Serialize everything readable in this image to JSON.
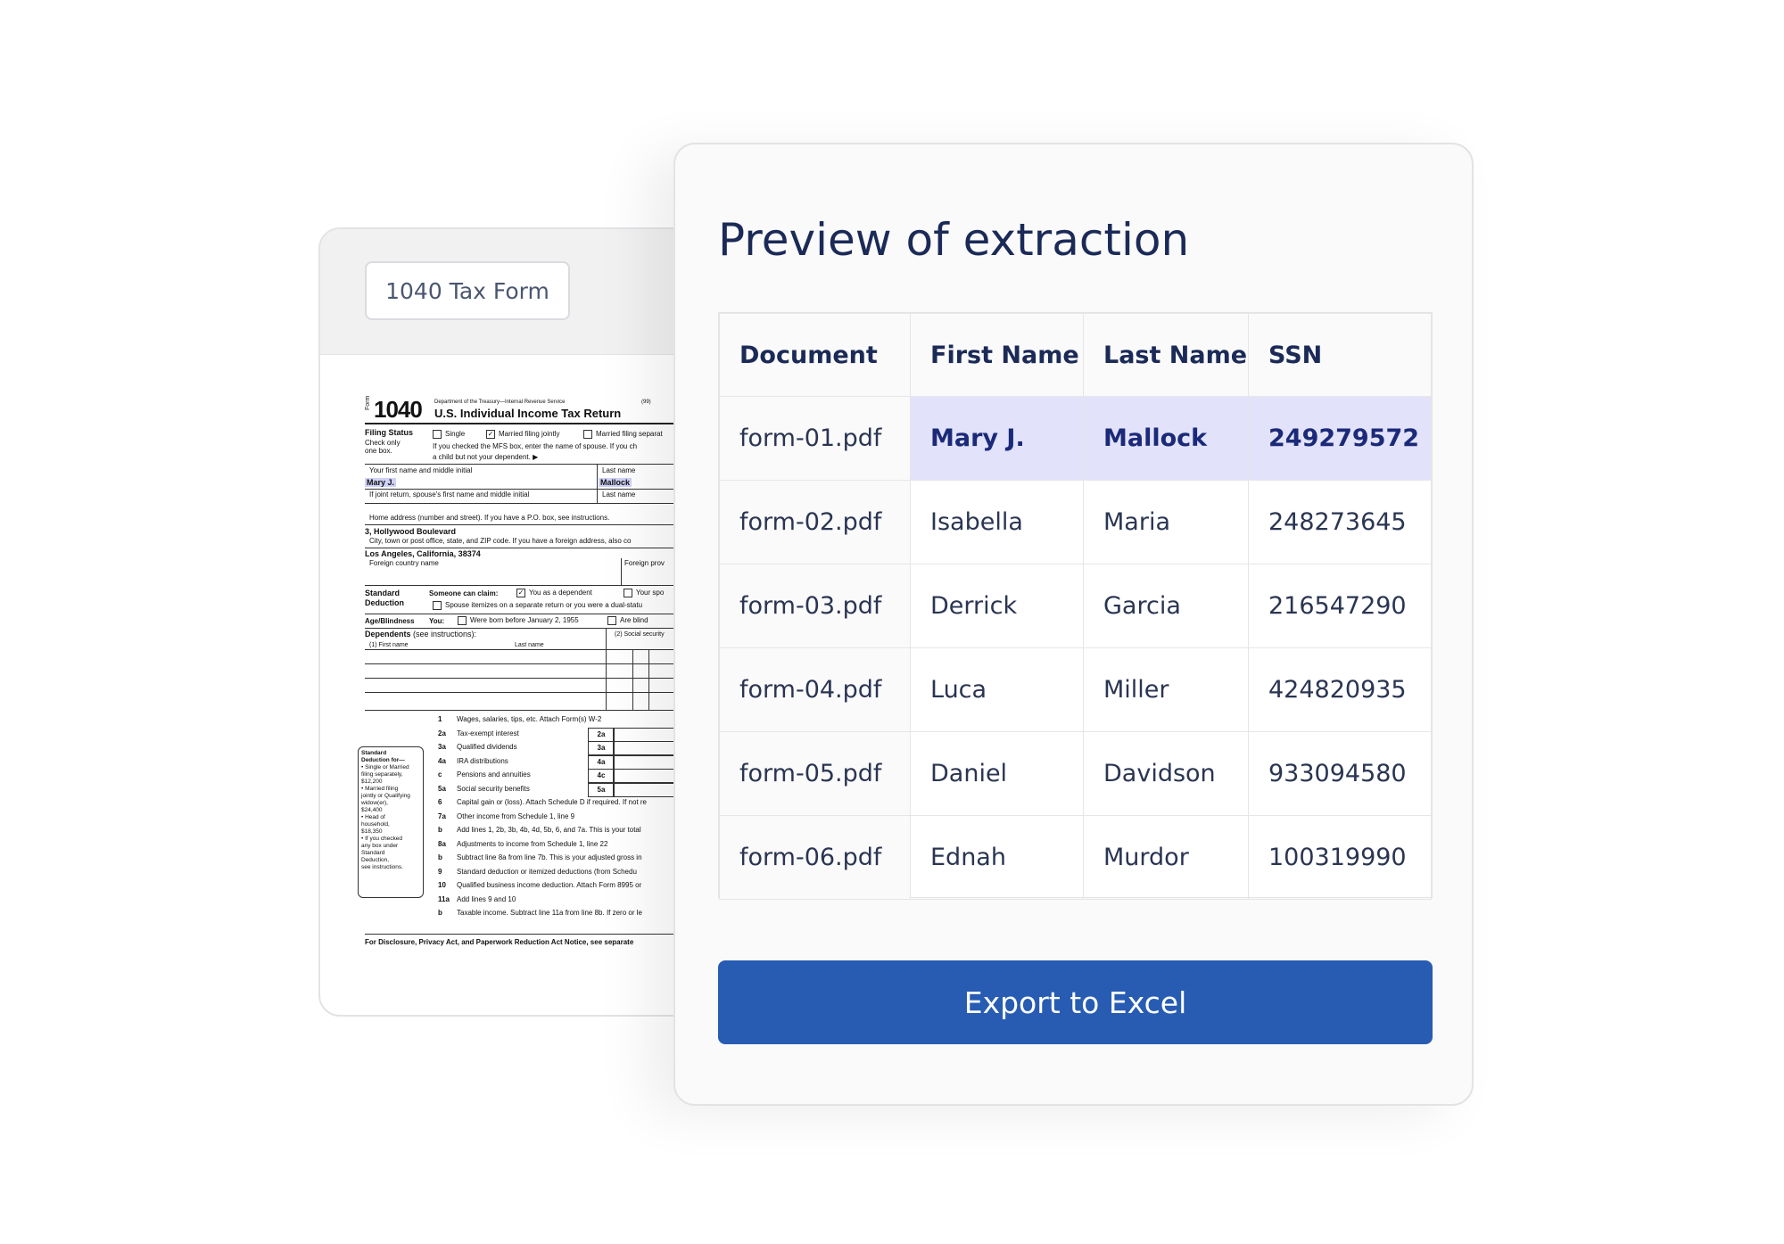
{
  "form_card": {
    "tag_label": "1040 Tax Form",
    "doc": {
      "form_label": "Form",
      "form_number": "1040",
      "dept": "Department of the Treasury—Internal Revenue Service",
      "code": "(99)",
      "title": "U.S. Individual Income Tax Return",
      "filing_status": "Filing Status",
      "check_only": "Check only",
      "one_box": "one box.",
      "single": "Single",
      "married_jointly": "Married filing jointly",
      "married_separately": "Married filing separat",
      "mfs_note": "If you checked the MFS box, enter the name of spouse. If you ch",
      "mfs_note2": "a child but not your dependent. ▶",
      "first_name_label": "Your first name and middle initial",
      "last_name_label": "Last name",
      "first_name_value": "Mary J.",
      "last_name_value": "Mallock",
      "spouse_label": "If joint return, spouse's first name and middle initial",
      "spouse_last_label": "Last name",
      "home_address_label": "Home address (number and street). If you have a P.O. box, see instructions.",
      "home_address_value": "3, Hollywood Boulevard",
      "city_label": "City, town or post office, state, and ZIP code. If you have a foreign address, also co",
      "city_value": "Los Angeles, California, 38374",
      "foreign_country": "Foreign country name",
      "foreign_prov": "Foreign prov",
      "standard": "Standard",
      "deduction": "Deduction",
      "someone_claim": "Someone can claim:",
      "you_dependent": "You as a dependent",
      "your_spouse": "Your spo",
      "spouse_itemizes": "Spouse itemizes on a separate return or you were a dual-statu",
      "age_blindness": "Age/Blindness",
      "you": "You:",
      "born_before": "Were born before January 2, 1955",
      "are_blind": "Are blind",
      "dependents": "Dependents",
      "see_instructions": "(see instructions):",
      "dep_first": "(1)  First name",
      "dep_last": "Last name",
      "dep_ssn": "(2)  Social security",
      "std_box": [
        "Standard",
        "Deduction for—",
        "• Single or Married",
        "filing separately,",
        "$12,200",
        "• Married filing",
        "jointly or Qualifying",
        "widow(er),",
        "$24,400",
        "• Head of",
        "household,",
        "$18,350",
        "• If you checked",
        "any box under",
        "Standard",
        "Deduction,",
        "see instructions."
      ],
      "lines": [
        {
          "num": "1",
          "text": "Wages, salaries, tips, etc. Attach Form(s) W-2",
          "box": ""
        },
        {
          "num": "2a",
          "text": "Tax-exempt interest",
          "box": "2a"
        },
        {
          "num": "3a",
          "text": "Qualified dividends",
          "box": "3a"
        },
        {
          "num": "4a",
          "text": "IRA distributions",
          "box": "4a"
        },
        {
          "num": "c",
          "text": "Pensions and annuities",
          "box": "4c"
        },
        {
          "num": "5a",
          "text": "Social security benefits",
          "box": "5a"
        },
        {
          "num": "6",
          "text": "Capital gain or (loss). Attach Schedule D if required. If not re",
          "box": ""
        },
        {
          "num": "7a",
          "text": "Other income from Schedule 1, line 9",
          "box": ""
        },
        {
          "num": "b",
          "text": "Add lines 1, 2b, 3b, 4b, 4d, 5b, 6, and 7a. This is your total",
          "box": ""
        },
        {
          "num": "8a",
          "text": "Adjustments to income from Schedule 1, line 22",
          "box": ""
        },
        {
          "num": "b",
          "text": "Subtract line 8a from line 7b. This is your adjusted gross in",
          "box": ""
        },
        {
          "num": "9",
          "text": "Standard deduction or itemized deductions (from Schedu",
          "box": ""
        },
        {
          "num": "10",
          "text": "Qualified business income deduction. Attach Form 8995 or",
          "box": ""
        },
        {
          "num": "11a",
          "text": "Add lines 9 and 10",
          "box": ""
        },
        {
          "num": "b",
          "text": "Taxable income. Subtract line 11a from line 8b. If zero or le",
          "box": ""
        }
      ],
      "footer": "For Disclosure, Privacy Act, and Paperwork Reduction Act Notice, see separate"
    }
  },
  "preview": {
    "title": "Preview of extraction",
    "columns": [
      "Document",
      "First Name",
      "Last Name",
      "SSN"
    ],
    "rows": [
      {
        "document": "form-01.pdf",
        "first_name": "Mary J.",
        "last_name": "Mallock",
        "ssn": "249279572"
      },
      {
        "document": "form-02.pdf",
        "first_name": "Isabella",
        "last_name": "Maria",
        "ssn": "248273645"
      },
      {
        "document": "form-03.pdf",
        "first_name": "Derrick",
        "last_name": "Garcia",
        "ssn": "216547290"
      },
      {
        "document": "form-04.pdf",
        "first_name": "Luca",
        "last_name": "Miller",
        "ssn": "424820935"
      },
      {
        "document": "form-05.pdf",
        "first_name": "Daniel",
        "last_name": "Davidson",
        "ssn": "933094580"
      },
      {
        "document": "form-06.pdf",
        "first_name": "Ednah",
        "last_name": "Murdor",
        "ssn": "100319990"
      }
    ],
    "highlighted_row": 0,
    "export_label": "Export to Excel"
  },
  "colors": {
    "accent": "#275cb2",
    "title": "#1b2a57",
    "highlight": "#e2e2fb"
  }
}
